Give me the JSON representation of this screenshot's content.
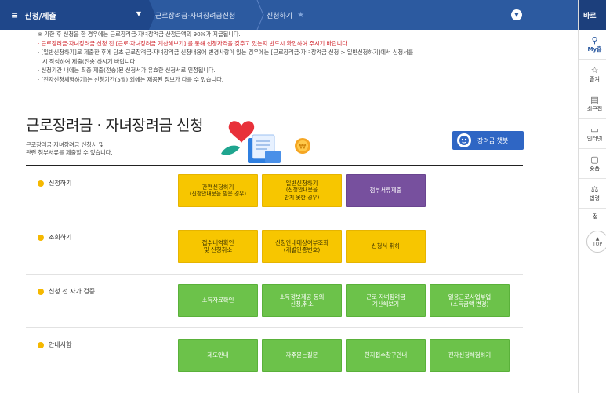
{
  "topnav": {
    "menu_label": "신청/제출",
    "crumb1": "근로장려금·자녀장려금신청",
    "crumb2": "신청하기"
  },
  "right_panel": {
    "header": "바로",
    "items": [
      "My홈",
      "즐겨",
      "최근접",
      "인터넷",
      "숏폼",
      "법령"
    ],
    "small": "접",
    "top": "TOP"
  },
  "notices": [
    "※ 기한 후 신청을 한 경우에는 근로장려금·자녀장려금 산정금액의 90%가 지급됩니다.",
    "· 근로장려금·자녀장려금 신청 전 [근로·자녀장려금 계산해보기] 를 통해 신청자격을 갖추고 있는지 반드시 확인하여 주시기 바랍니다.",
    "· [일반신청하기]로 제출한 후에 당초 근로장려금·자녀장려금 신청내용에 변경사항이 있는 경우에는 [근로장려금·자녀장려금 신청 > 일반신청하기]에서 신청서를",
    "시 작성하여 제출(전송)하시기 바랍니다.",
    "· 신청기간 내에는 최종 제출(전송)된 신청서가 유효한 신청서로 인정됩니다.",
    "· [전자신청체험하기]는 신청기간(5월) 외에는 제공된 정보가 다를 수 있습니다."
  ],
  "page": {
    "title": "근로장려금 · 자녀장려금 신청",
    "subtitle_line1": "근로장려금·자녀장려금 신청서 및",
    "subtitle_line2": "관련 첨부서류를 제출할 수 있습니다.",
    "chatbot": "장려금 챗봇"
  },
  "sections": {
    "apply": {
      "label": "신청하기",
      "simple": "간편신청하기",
      "simple_sub": "(신청안내문을 받은 경우)",
      "general": "일반신청하기",
      "general_sub1": "(신청안내문을",
      "general_sub2": "받지 못한 경우)",
      "attach": "첨부서류제출"
    },
    "lookup": {
      "label": "조회하기",
      "receipt1": "접수내역확인",
      "receipt2": "및 신청취소",
      "target1": "신청안내대상여부조회",
      "target2": "(개별인증번호)",
      "cancel": "신청서 취하"
    },
    "verify": {
      "label": "신청 전 자가 검증",
      "income": "소득자료확인",
      "consent1": "소득정보제공 동의",
      "consent2": "신청,취소",
      "calc1": "근로·자녀장려금",
      "calc2": "계산해보기",
      "daily1": "일용근로사업부업",
      "daily2": "(소득금액 변경)"
    },
    "guide": {
      "label": "안내사항",
      "system": "제도안내",
      "faq": "자주묻는질문",
      "onsite": "현지접수창구안내",
      "trial": "전자신청체험하기"
    }
  }
}
